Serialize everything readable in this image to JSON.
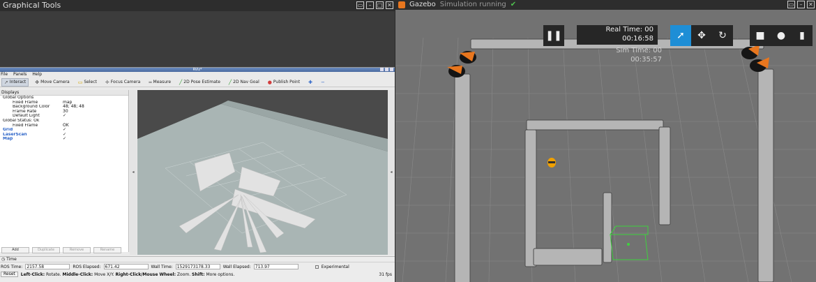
{
  "left_window": {
    "title": "Graphical Tools",
    "controls": [
      "▭",
      "–",
      "□",
      "✕"
    ],
    "rviz": {
      "title": "RViz*",
      "menus": [
        "File",
        "Panels",
        "Help"
      ],
      "toolbar": [
        {
          "label": "Interact",
          "icon": "interact-icon",
          "active": true
        },
        {
          "label": "Move Camera",
          "icon": "move-camera-icon",
          "active": false
        },
        {
          "label": "Select",
          "icon": "select-icon",
          "active": false
        },
        {
          "label": "Focus Camera",
          "icon": "focus-camera-icon",
          "active": false
        },
        {
          "label": "Measure",
          "icon": "measure-icon",
          "active": false
        },
        {
          "label": "2D Pose Estimate",
          "icon": "pose-estimate-icon",
          "active": false
        },
        {
          "label": "2D Nav Goal",
          "icon": "nav-goal-icon",
          "active": false
        },
        {
          "label": "Publish Point",
          "icon": "publish-point-icon",
          "active": false
        }
      ],
      "displays": {
        "header": "Displays",
        "rows": [
          {
            "key": "Global Options",
            "value": "",
            "style": "normal"
          },
          {
            "key": "Fixed Frame",
            "value": "map",
            "style": "normal"
          },
          {
            "key": "Background Color",
            "value": "48; 48; 48",
            "style": "normal"
          },
          {
            "key": "Frame Rate",
            "value": "30",
            "style": "normal"
          },
          {
            "key": "Default Light",
            "value": "✓",
            "style": "normal"
          },
          {
            "key": "Global Status: Ok",
            "value": "",
            "style": "normal"
          },
          {
            "key": "Fixed Frame",
            "value": "OK",
            "style": "normal"
          },
          {
            "key": "Grid",
            "value": "✓",
            "style": "blue"
          },
          {
            "key": "LaserScan",
            "value": "✓",
            "style": "blue"
          },
          {
            "key": "Map",
            "value": "✓",
            "style": "blue"
          }
        ],
        "buttons": [
          "Add",
          "Duplicate",
          "Remove",
          "Rename"
        ]
      },
      "time": {
        "header": "Time",
        "ros_time_label": "ROS Time:",
        "ros_time": "2157.58",
        "ros_elapsed_label": "ROS Elapsed:",
        "ros_elapsed": "671.42",
        "wall_time_label": "Wall Time:",
        "wall_time": "1529173178.33",
        "wall_elapsed_label": "Wall Elapsed:",
        "wall_elapsed": "713.97",
        "experimental_label": "Experimental",
        "reset_label": "Reset",
        "hint_left_bold": "Left-Click:",
        "hint_left": "Rotate.",
        "hint_middle_bold": "Middle-Click:",
        "hint_middle": "Move X/Y.",
        "hint_right_bold": "Right-Click/Mouse Wheel:",
        "hint_right": "Zoom.",
        "hint_shift_bold": "Shift:",
        "hint_shift": "More options.",
        "fps": "31 fps"
      }
    }
  },
  "right_window": {
    "title": "Gazebo",
    "status": "Simulation running",
    "controls": [
      "▭",
      "–",
      "✕"
    ],
    "real_time_label": "Real Time: 00",
    "real_time_value": "00:16:58",
    "sim_time_label": "Sim Time: 00",
    "sim_time_value": "00:35:57",
    "colors": {
      "select_active": "#1e8ed6",
      "ground": "#727272",
      "selection_box": "#3fd13f",
      "cone_orange": "#e8761e"
    }
  }
}
